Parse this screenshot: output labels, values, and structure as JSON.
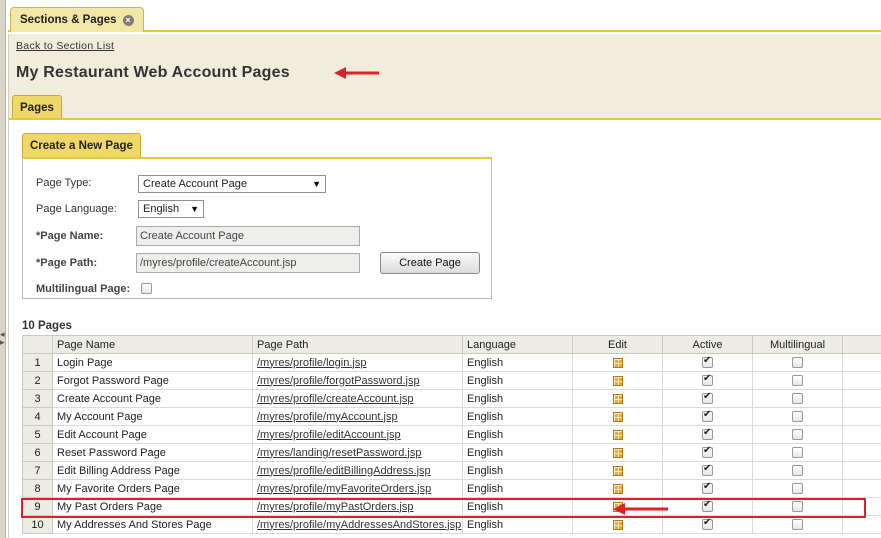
{
  "outer_tab": {
    "label": "Sections & Pages"
  },
  "header": {
    "back_link": "Back to Section List",
    "title": "My Restaurant Web Account Pages"
  },
  "inner_tab": {
    "label": "Pages"
  },
  "create_form": {
    "tab_label": "Create a New Page",
    "page_type_label": "Page Type:",
    "page_type_value": "Create Account Page",
    "page_language_label": "Page Language:",
    "page_language_value": "English",
    "page_name_label": "*Page Name:",
    "page_name_value": "Create Account Page",
    "page_path_label": "*Page Path:",
    "page_path_value": "/myres/profile/createAccount.jsp",
    "multilingual_label": "Multilingual Page:",
    "create_button": "Create Page"
  },
  "pages_table": {
    "count_label": "10 Pages",
    "columns": [
      "",
      "Page Name",
      "Page Path",
      "Language",
      "Edit",
      "Active",
      "Multilingual"
    ],
    "rows": [
      {
        "num": "1",
        "name": "Login Page",
        "path": "/myres/profile/login.jsp",
        "language": "English",
        "active": true,
        "multilingual": false
      },
      {
        "num": "2",
        "name": "Forgot Password Page",
        "path": "/myres/profile/forgotPassword.jsp",
        "language": "English",
        "active": true,
        "multilingual": false
      },
      {
        "num": "3",
        "name": "Create Account Page",
        "path": "/myres/profile/createAccount.jsp",
        "language": "English",
        "active": true,
        "multilingual": false
      },
      {
        "num": "4",
        "name": "My Account Page",
        "path": "/myres/profile/myAccount.jsp",
        "language": "English",
        "active": true,
        "multilingual": false
      },
      {
        "num": "5",
        "name": "Edit Account Page",
        "path": "/myres/profile/editAccount.jsp",
        "language": "English",
        "active": true,
        "multilingual": false
      },
      {
        "num": "6",
        "name": "Reset Password Page",
        "path": "/myres/landing/resetPassword.jsp",
        "language": "English",
        "active": true,
        "multilingual": false
      },
      {
        "num": "7",
        "name": "Edit Billing Address Page",
        "path": "/myres/profile/editBillingAddress.jsp",
        "language": "English",
        "active": true,
        "multilingual": false
      },
      {
        "num": "8",
        "name": "My Favorite Orders Page",
        "path": "/myres/profile/myFavoriteOrders.jsp",
        "language": "English",
        "active": true,
        "multilingual": false
      },
      {
        "num": "9",
        "name": "My Past Orders Page",
        "path": "/myres/profile/myPastOrders.jsp",
        "language": "English",
        "active": true,
        "multilingual": false
      },
      {
        "num": "10",
        "name": "My Addresses And Stores Page",
        "path": "/myres/profile/myAddressesAndStores.jsp",
        "language": "English",
        "active": true,
        "multilingual": false
      }
    ]
  },
  "colors": {
    "accent_yellow": "#e4c640",
    "tab_yellow": "#f0d868",
    "header_bg": "#f1eddc",
    "annotation_red": "#d9232a"
  },
  "icons": {
    "close": "close-icon",
    "edit": "edit-icon",
    "annotation_arrow": "arrow-left-icon"
  }
}
